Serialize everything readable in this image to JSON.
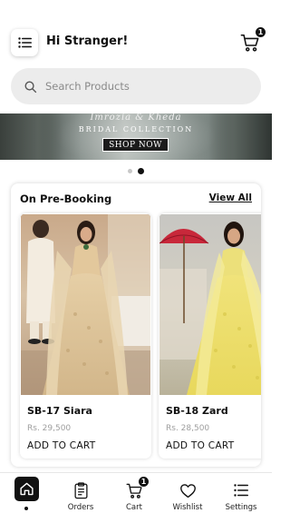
{
  "header": {
    "greeting": "Hi Stranger!",
    "cart_count": "1"
  },
  "search": {
    "placeholder": "Search Products"
  },
  "banner": {
    "script_text": "Imrozia & Kheda",
    "collection_text": "BRIDAL COLLECTION",
    "button_label": "SHOP NOW",
    "slide_count": 2,
    "active_slide": 2
  },
  "pre_booking": {
    "title": "On Pre-Booking",
    "view_all": "View All",
    "products": [
      {
        "name": "SB-17 Siara",
        "price": "Rs. 29,500",
        "action": "ADD TO CART"
      },
      {
        "name": "SB-18 Zard",
        "price": "Rs. 28,500",
        "action": "ADD TO CART"
      }
    ]
  },
  "bottom_nav": {
    "items": [
      {
        "label": "",
        "icon": "home-icon",
        "active": true
      },
      {
        "label": "Orders",
        "icon": "orders-icon"
      },
      {
        "label": "Cart",
        "icon": "cart-icon",
        "badge": "1"
      },
      {
        "label": "Wishlist",
        "icon": "heart-icon"
      },
      {
        "label": "Settings",
        "icon": "settings-icon"
      }
    ]
  },
  "colors": {
    "primary": "#111111",
    "search_bg": "#ececec",
    "price": "#9e9e9e"
  }
}
